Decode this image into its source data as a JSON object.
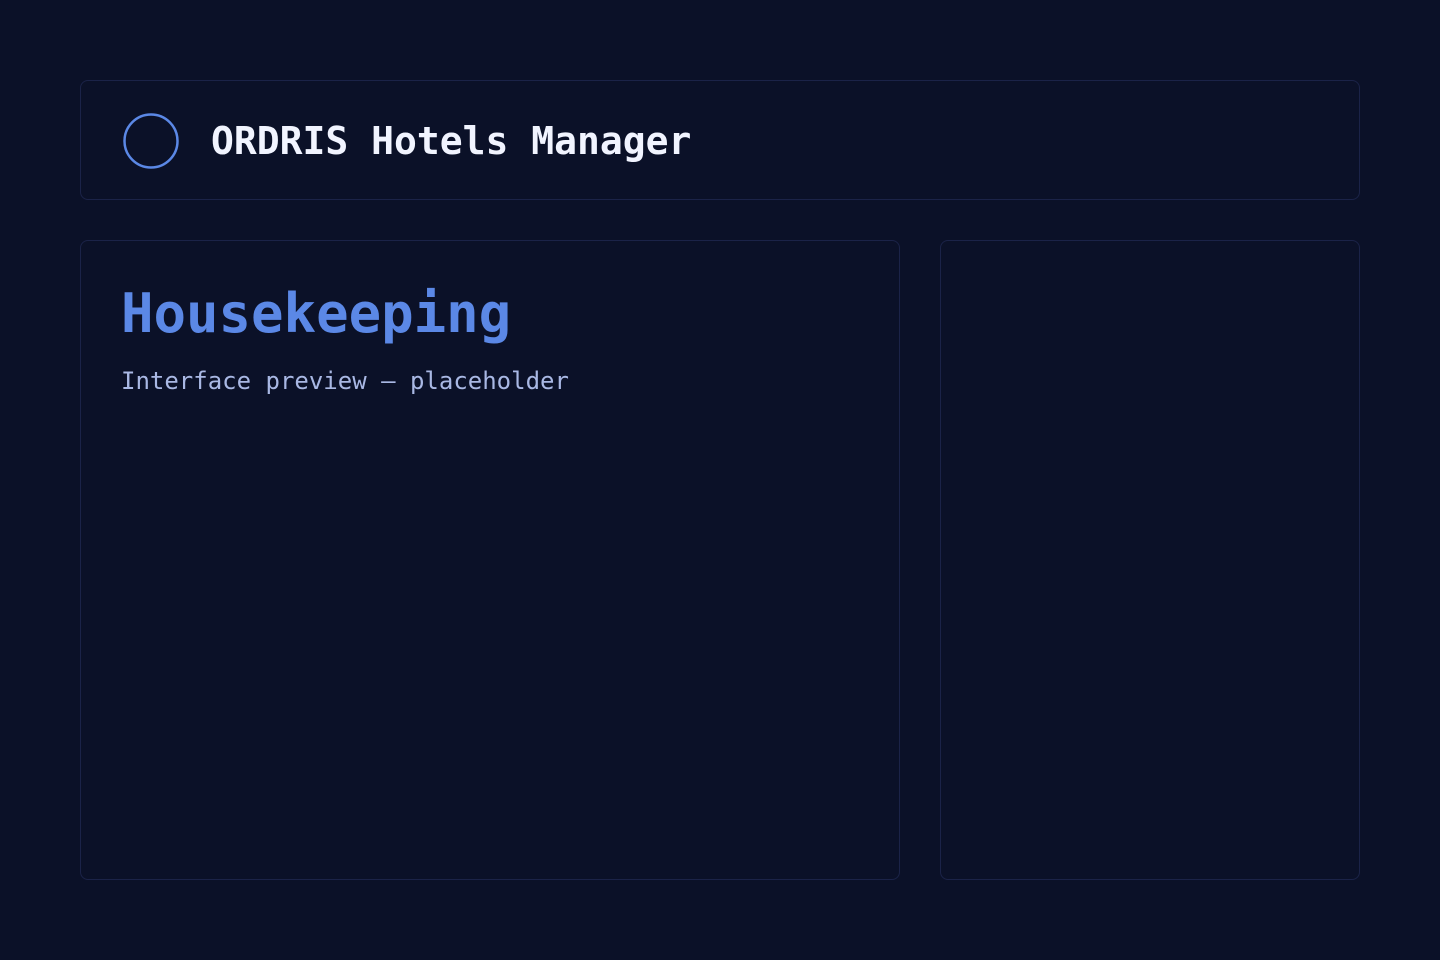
{
  "header": {
    "logo_icon": "circle-logo-icon",
    "title": "ORDRIS Hotels Manager"
  },
  "main": {
    "title": "Housekeeping",
    "subtitle": "Interface preview — placeholder"
  },
  "side_panel": {},
  "colors": {
    "background": "#0b1128",
    "panel_border": "#1b2348",
    "accent": "#5b88e6",
    "title_text": "#f1f4ff",
    "subtitle_text": "#a9b8e4"
  }
}
